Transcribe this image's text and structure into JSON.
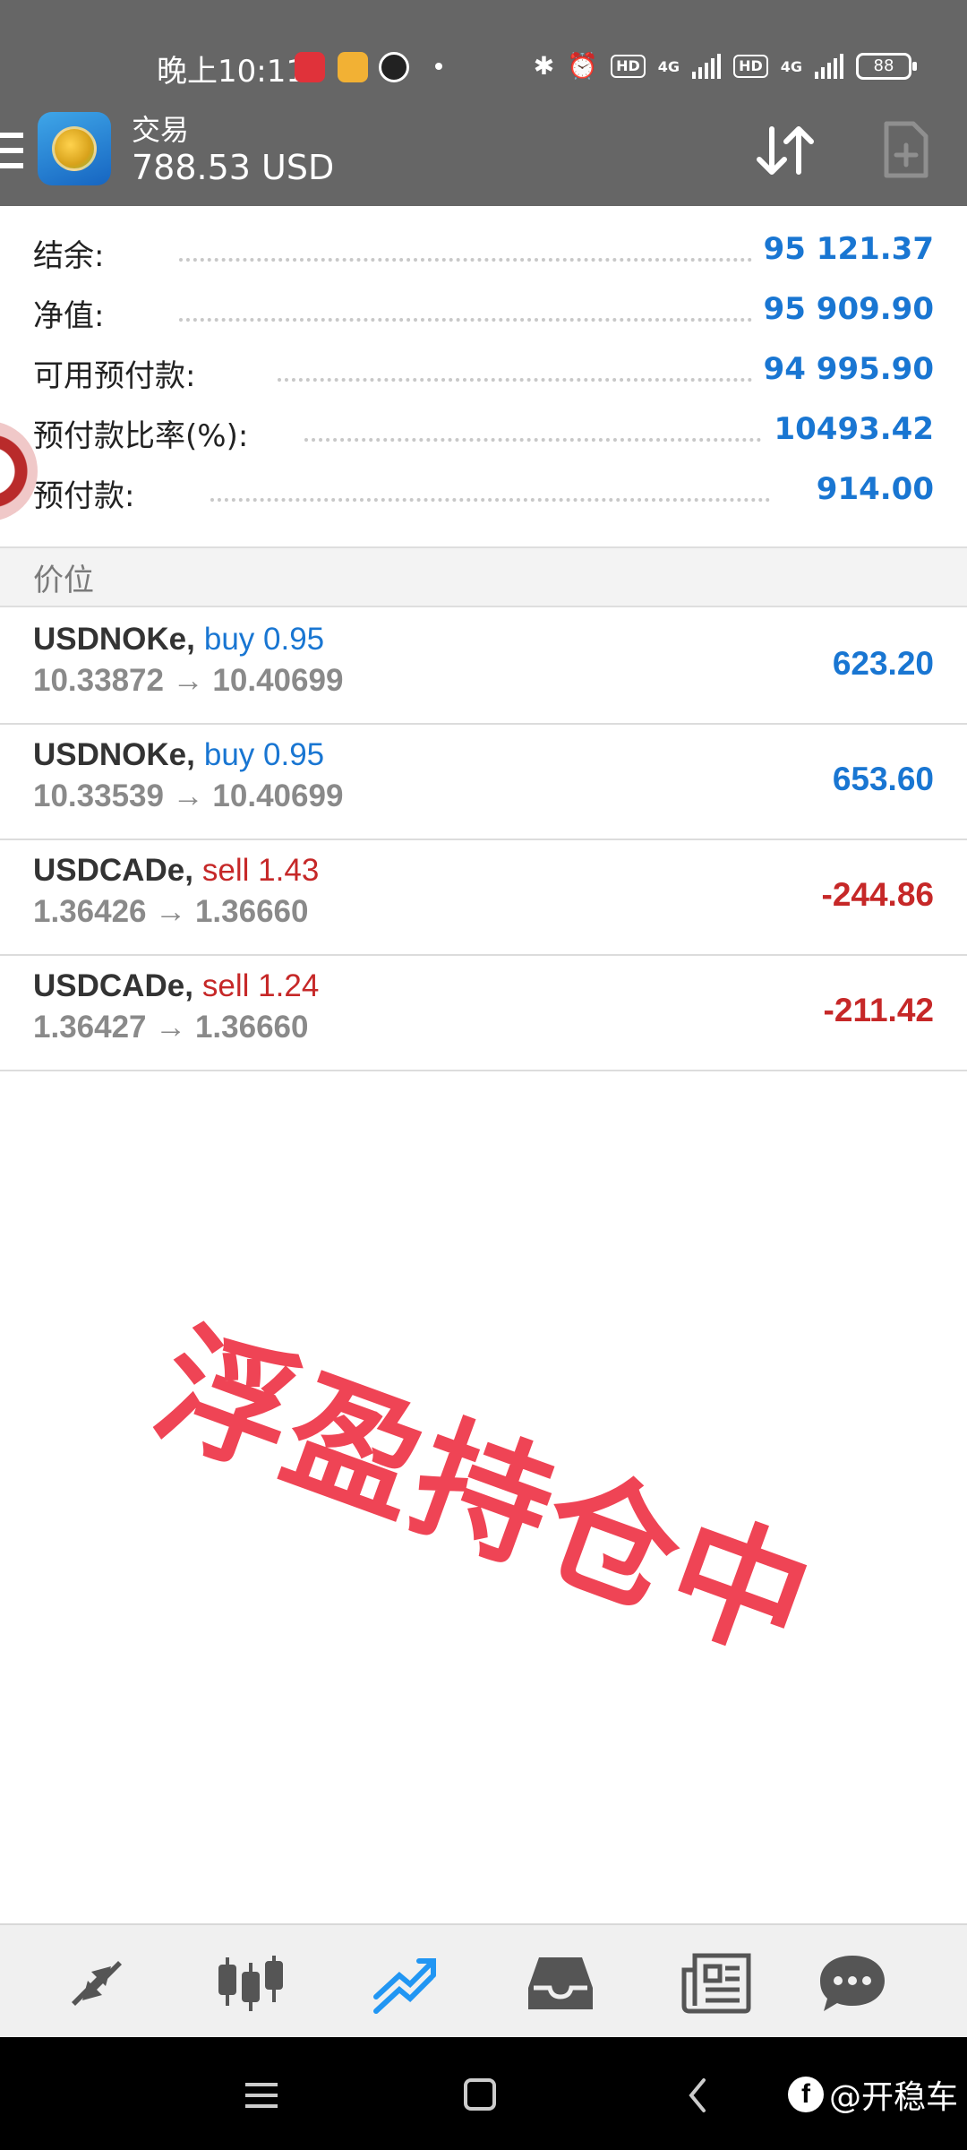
{
  "status_bar": {
    "time": "晚上10:11",
    "signal_1": "4G",
    "signal_2": "4G",
    "hd_1": "HD",
    "hd_2": "HD",
    "battery": "88"
  },
  "header": {
    "title": "交易",
    "profit": "788.53 USD"
  },
  "summary": [
    {
      "label": "结余:",
      "value": "95 121.37"
    },
    {
      "label": "净值:",
      "value": "95 909.90"
    },
    {
      "label": "可用预付款:",
      "value": "94 995.90"
    },
    {
      "label": "预付款比率(%):",
      "value": "10493.42"
    },
    {
      "label": "预付款:",
      "value": "914.00"
    }
  ],
  "section_title": "价位",
  "positions": [
    {
      "symbol": "USDNOKe,",
      "side": "buy 0.95",
      "side_type": "buy",
      "prices": "10.33872 → 10.40699",
      "profit": "623.20"
    },
    {
      "symbol": "USDNOKe,",
      "side": "buy 0.95",
      "side_type": "buy",
      "prices": "10.33539 → 10.40699",
      "profit": "653.60"
    },
    {
      "symbol": "USDCADe,",
      "side": "sell 1.43",
      "side_type": "sell",
      "prices": "1.36426 → 1.36660",
      "profit": "-244.86"
    },
    {
      "symbol": "USDCADe,",
      "side": "sell 1.24",
      "side_type": "sell",
      "prices": "1.36427 → 1.36660",
      "profit": "-211.42"
    }
  ],
  "watermark": "浮盈持仓中",
  "bottom_nav": [
    "quotes-icon",
    "chart-candles-icon",
    "trade-icon",
    "history-inbox-icon",
    "news-icon",
    "chat-icon"
  ],
  "brand": "@开稳车",
  "colors": {
    "header_bg": "#666666",
    "accent_blue": "#1976d2",
    "sell_red": "#c62828",
    "watermark_red": "#ef3b4c"
  }
}
